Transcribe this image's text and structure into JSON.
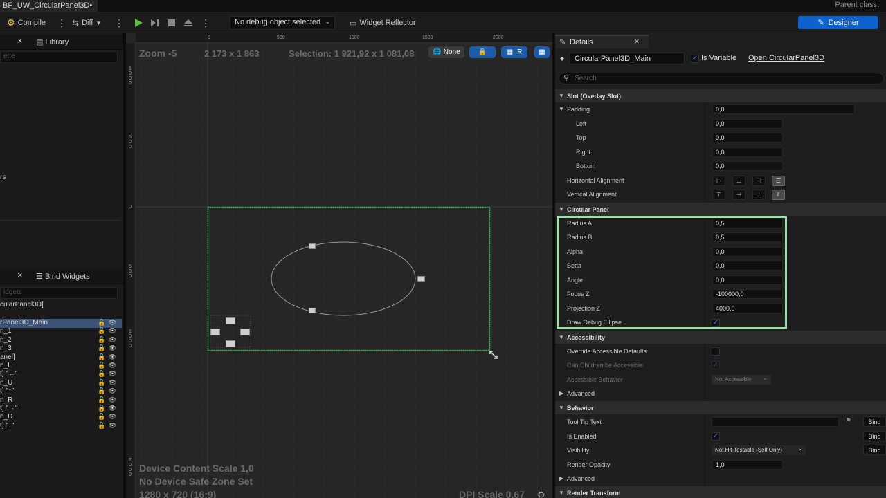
{
  "titlebar": {
    "tab_title": "BP_UW_CircularPanel3D•",
    "parent_class": "Parent class:"
  },
  "toolbar": {
    "compile": "Compile",
    "diff": "Diff",
    "debug_object": "No debug object selected",
    "widget_reflector": "Widget Reflector",
    "designer": "Designer"
  },
  "left_panel": {
    "palette_tab": "",
    "palette_search": "ette",
    "library_tab": "Library",
    "partial_text": "rs",
    "hierarchy_tab": "",
    "bind_widgets_tab": "Bind Widgets",
    "hierarchy_search": "idgets",
    "root": "cularPanel3D]",
    "items": [
      "rPanel3D_Main",
      "n_1",
      "n_2",
      "n_3",
      "anel]",
      "n_L",
      "t] \"←\"",
      "n_U",
      "t] \"↑\"",
      "n_R",
      "t] \"→\"",
      "n_D",
      "t] \"↓\""
    ]
  },
  "canvas": {
    "zoom": "Zoom -5",
    "size": "2 173 x 1 863",
    "selection": "Selection: 1 921,92 x 1 081,08",
    "none_label": "None",
    "r_label": "R",
    "ruler_h": [
      "0",
      "500",
      "1000",
      "1500",
      "2000"
    ],
    "ruler_v": [
      "1\n0\n0\n0",
      "5\n0\n0",
      "0",
      "5\n0\n0",
      "1\n0\n0\n0",
      "2\n0\n0\n0"
    ],
    "device_scale": "Device Content Scale 1,0",
    "safe_zone": "No Device Safe Zone Set",
    "resolution": "1280 x 720 (16:9)",
    "dpi_scale": "DPI Scale 0,67"
  },
  "details": {
    "tab": "Details",
    "widget_name": "CircularPanel3D_Main",
    "is_variable_label": "Is Variable",
    "is_variable": true,
    "open_link": "Open CircularPanel3D",
    "search_placeholder": "Search",
    "sections": {
      "slot": "Slot (Overlay Slot)",
      "circular_panel": "Circular Panel",
      "accessibility": "Accessibility",
      "behavior": "Behavior",
      "render_transform": "Render Transform"
    },
    "padding": {
      "label": "Padding",
      "value": "0,0"
    },
    "padding_left": {
      "label": "Left",
      "value": "0,0"
    },
    "padding_top": {
      "label": "Top",
      "value": "0,0"
    },
    "padding_right": {
      "label": "Right",
      "value": "0,0"
    },
    "padding_bottom": {
      "label": "Bottom",
      "value": "0,0"
    },
    "h_align": "Horizontal Alignment",
    "v_align": "Vertical Alignment",
    "radius_a": {
      "label": "Radius A",
      "value": "0,5"
    },
    "radius_b": {
      "label": "Radius B",
      "value": "0,5"
    },
    "alpha": {
      "label": "Alpha",
      "value": "0,0"
    },
    "betta": {
      "label": "Betta",
      "value": "0,0"
    },
    "angle": {
      "label": "Angle",
      "value": "0,0"
    },
    "focus_z": {
      "label": "Focus Z",
      "value": "-100000,0"
    },
    "projection_z": {
      "label": "Projection Z",
      "value": "4000,0"
    },
    "draw_debug": {
      "label": "Draw Debug Ellipse",
      "value": true
    },
    "override_defaults": "Override Accessible Defaults",
    "can_children": "Can Children be Accessible",
    "accessible_behavior": {
      "label": "Accessible Behavior",
      "value": "Not Accessible"
    },
    "advanced": "Advanced",
    "tooltip": {
      "label": "Tool Tip Text",
      "value": ""
    },
    "is_enabled": {
      "label": "Is Enabled",
      "value": true
    },
    "visibility": {
      "label": "Visibility",
      "value": "Not Hit-Testable (Self Only)"
    },
    "render_opacity": {
      "label": "Render Opacity",
      "value": "1,0"
    },
    "bind": "Bind"
  },
  "colors": {
    "accent_blue": "#0f62c9",
    "selection_green": "#35c24a",
    "highlight_box": "#9ee0a8",
    "hierarchy_selected": "#3b5378"
  }
}
